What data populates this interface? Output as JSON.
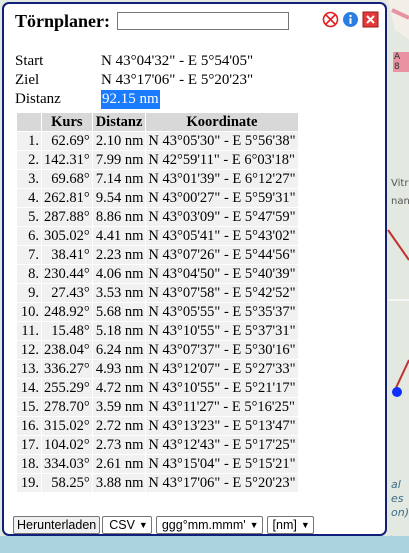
{
  "map": {
    "labels": [
      "A 8",
      "Vitr",
      "nane",
      "al",
      "es",
      "on)"
    ]
  },
  "panel": {
    "title": "Törnplaner:",
    "name_value": "",
    "icons": [
      "delete-icon",
      "info-icon",
      "close-icon"
    ]
  },
  "route": {
    "start_label": "Start",
    "start_value": "N 43°04'32\" - E 5°54'05\"",
    "goal_label": "Ziel",
    "goal_value": "N 43°17'06\" - E 5°20'23\"",
    "distance_label": "Distanz",
    "distance_value": "92.15 nm"
  },
  "table": {
    "headers": [
      "",
      "Kurs",
      "Distanz",
      "Koordinate"
    ],
    "rows": [
      {
        "n": "1.",
        "k": "62.69°",
        "d": "2.10 nm",
        "c": "N 43°05'30\" - E 5°56'38\""
      },
      {
        "n": "2.",
        "k": "142.31°",
        "d": "7.99 nm",
        "c": "N 42°59'11\" - E 6°03'18\""
      },
      {
        "n": "3.",
        "k": "69.68°",
        "d": "7.14 nm",
        "c": "N 43°01'39\" - E 6°12'27\""
      },
      {
        "n": "4.",
        "k": "262.81°",
        "d": "9.54 nm",
        "c": "N 43°00'27\" - E 5°59'31\""
      },
      {
        "n": "5.",
        "k": "287.88°",
        "d": "8.86 nm",
        "c": "N 43°03'09\" - E 5°47'59\""
      },
      {
        "n": "6.",
        "k": "305.02°",
        "d": "4.41 nm",
        "c": "N 43°05'41\" - E 5°43'02\""
      },
      {
        "n": "7.",
        "k": "38.41°",
        "d": "2.23 nm",
        "c": "N 43°07'26\" - E 5°44'56\""
      },
      {
        "n": "8.",
        "k": "230.44°",
        "d": "4.06 nm",
        "c": "N 43°04'50\" - E 5°40'39\""
      },
      {
        "n": "9.",
        "k": "27.43°",
        "d": "3.53 nm",
        "c": "N 43°07'58\" - E 5°42'52\""
      },
      {
        "n": "10.",
        "k": "248.92°",
        "d": "5.68 nm",
        "c": "N 43°05'55\" - E 5°35'37\""
      },
      {
        "n": "11.",
        "k": "15.48°",
        "d": "5.18 nm",
        "c": "N 43°10'55\" - E 5°37'31\""
      },
      {
        "n": "12.",
        "k": "238.04°",
        "d": "6.24 nm",
        "c": "N 43°07'37\" - E 5°30'16\""
      },
      {
        "n": "13.",
        "k": "336.27°",
        "d": "4.93 nm",
        "c": "N 43°12'07\" - E 5°27'33\""
      },
      {
        "n": "14.",
        "k": "255.29°",
        "d": "4.72 nm",
        "c": "N 43°10'55\" - E 5°21'17\""
      },
      {
        "n": "15.",
        "k": "278.70°",
        "d": "3.59 nm",
        "c": "N 43°11'27\" - E 5°16'25\""
      },
      {
        "n": "16.",
        "k": "315.02°",
        "d": "2.72 nm",
        "c": "N 43°13'23\" - E 5°13'47\""
      },
      {
        "n": "17.",
        "k": "104.02°",
        "d": "2.73 nm",
        "c": "N 43°12'43\" - E 5°17'25\""
      },
      {
        "n": "18.",
        "k": "334.03°",
        "d": "2.61 nm",
        "c": "N 43°15'04\" - E 5°15'21\""
      },
      {
        "n": "19.",
        "k": "58.25°",
        "d": "3.88 nm",
        "c": "N 43°17'06\" - E 5°20'23\""
      }
    ]
  },
  "footer": {
    "download_label": "Herunterladen",
    "format_value": "CSV",
    "coord_format_value": "ggg°mm.mmm'",
    "unit_value": "[nm]"
  }
}
